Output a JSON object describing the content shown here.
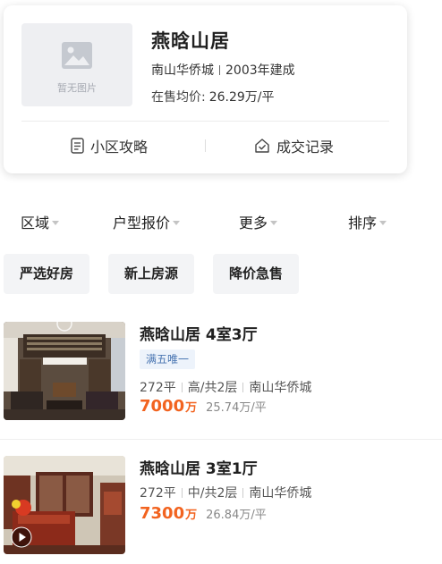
{
  "community": {
    "thumb_placeholder_icon": "image-icon",
    "thumb_placeholder_text": "暂无图片",
    "name": "燕晗山居",
    "area": "南山华侨城",
    "built": "2003年建成",
    "avg_price_label": "在售均价:",
    "avg_price_value": "26.29万/平",
    "actions": [
      {
        "label": "小区攻略",
        "icon": "document-icon"
      },
      {
        "label": "成交记录",
        "icon": "house-check-icon"
      }
    ]
  },
  "filters": [
    "区域",
    "户型报价",
    "更多",
    "排序"
  ],
  "quick_tags": [
    "严选好房",
    "新上房源",
    "降价急售"
  ],
  "listings": [
    {
      "title": "燕晗山居 4室3厅",
      "badge": "满五唯一",
      "size": "272平",
      "floor": "高/共2层",
      "area": "南山华侨城",
      "total_price": "7000",
      "total_unit": "万",
      "unit_price": "25.74万/平",
      "has_video": false
    },
    {
      "title": "燕晗山居 3室1厅",
      "badge": "",
      "size": "272平",
      "floor": "中/共2层",
      "area": "南山华侨城",
      "total_price": "7300",
      "total_unit": "万",
      "unit_price": "26.84万/平",
      "has_video": true
    }
  ],
  "colors": {
    "accent_price": "#f2631f",
    "badge_bg": "#edf3fb",
    "badge_text": "#4a76b2",
    "tag_bg": "#f3f4f6"
  }
}
